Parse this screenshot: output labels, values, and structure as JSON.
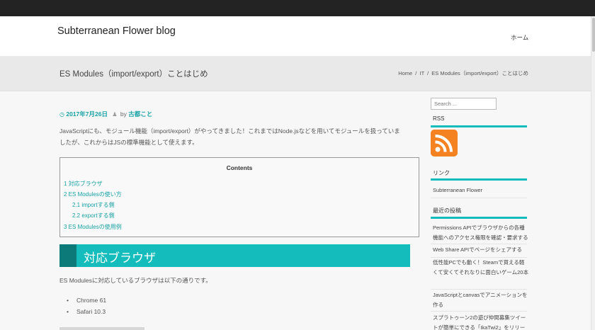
{
  "site": {
    "title": "Subterranean Flower blog",
    "nav_home": "ホーム"
  },
  "banner": {
    "page_title": "ES Modules（import/export）ことはじめ",
    "breadcrumb": [
      "Home",
      "IT",
      "ES Modules（import/export）ことはじめ"
    ],
    "separator": "/"
  },
  "meta": {
    "clock_icon": "clock-icon",
    "date": "2017年7月26日",
    "by": "by",
    "user_icon": "user-icon",
    "author": "古都こと"
  },
  "intro": {
    "line1": "JavaScriptにも、モジュール機能（import/export）がやってきました！これまではNode.jsなどを用いてモジュールを扱っていま",
    "line2": "したが、これからはJSの標準機能として使えます。"
  },
  "toc": {
    "title": "Contents",
    "items": [
      "1 対応ブラウザ",
      "2 ES Modulesの使い方",
      "2.1 importする側",
      "2.2 exportする側",
      "3 ES Modulesの使用例"
    ]
  },
  "section": {
    "heading": "対応ブラウザ"
  },
  "body": {
    "para": "ES Modulesに対応しているブラウザは以下の通りです。",
    "browsers": [
      "Chrome 61",
      "Safari 10.3"
    ],
    "bullet": "•"
  },
  "sidebar": {
    "search_placeholder": "Search ...",
    "rss_title": "RSS",
    "links_title": "リンク",
    "links": [
      "Subterranean Flower"
    ],
    "recent_title": "最近の投稿",
    "recent_posts": [
      "Permissions APIでブラウザからの各種機能へのアクセス権限を確認・要求する",
      "Web Share APIでページをシェアする",
      "低性能PCでも動く！Steamで買える軽くて安くてそれなりに面白いゲーム20本",
      "JavaScriptとcanvasでアニメーションを作る",
      "スプラトゥーン2の遊び仲間募集ツイートが簡単にできる「IkaTwi2」をリリー"
    ]
  },
  "colors": {
    "accent": "#14bcbc",
    "accent_dark": "#0d7a7a",
    "rss": "#f58220",
    "topbar": "#232323"
  }
}
